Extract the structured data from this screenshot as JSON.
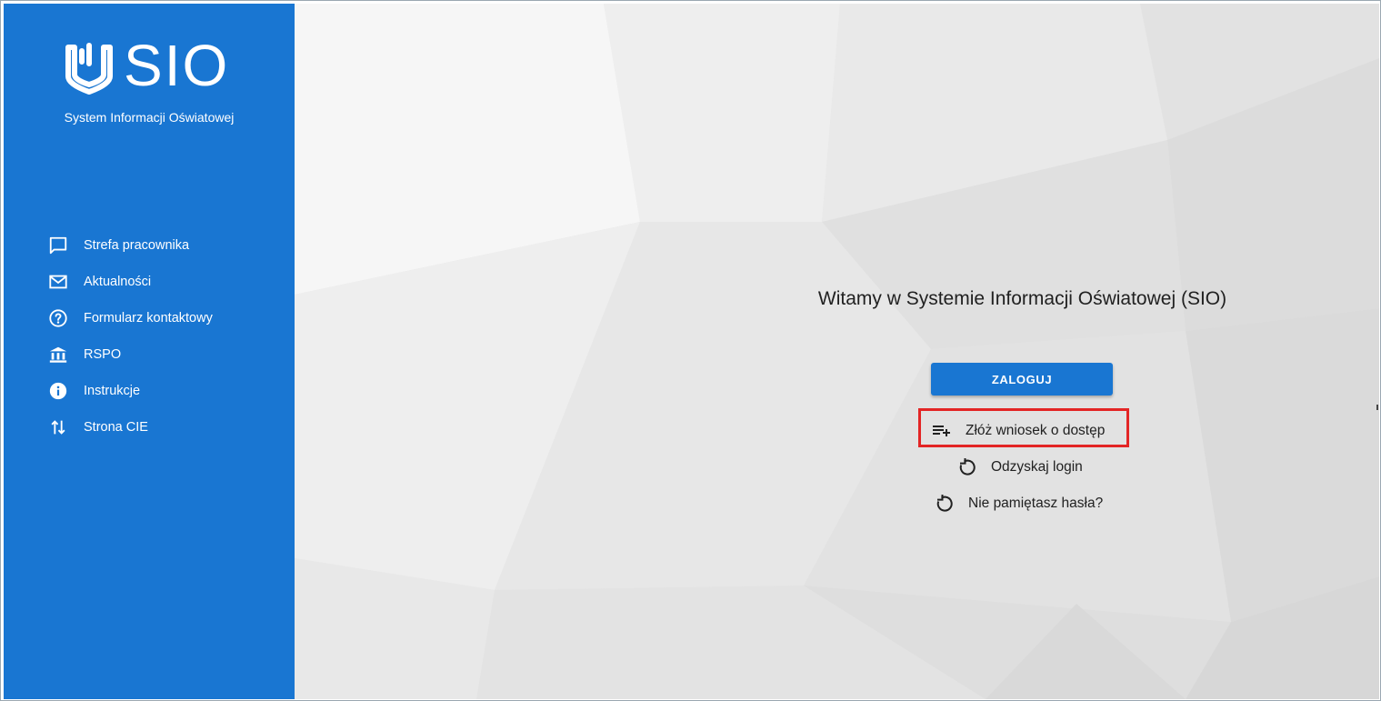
{
  "app": {
    "logo_text": "SIO",
    "subtitle": "System Informacji Oświatowej"
  },
  "sidebar": {
    "items": [
      {
        "label": "Strefa pracownika",
        "icon": "chat-bubble-icon"
      },
      {
        "label": "Aktualności",
        "icon": "mail-icon"
      },
      {
        "label": "Formularz kontaktowy",
        "icon": "help-circle-icon"
      },
      {
        "label": "RSPO",
        "icon": "bank-icon"
      },
      {
        "label": "Instrukcje",
        "icon": "info-icon"
      },
      {
        "label": "Strona CIE",
        "icon": "swap-vertical-icon"
      }
    ]
  },
  "main": {
    "title": "Witamy w Systemie Informacji Oświatowej (SIO)",
    "login_button": "ZALOGUJ",
    "actions": [
      {
        "label": "Złóż wniosek o dostęp",
        "icon": "playlist-add-icon"
      },
      {
        "label": "Odzyskaj login",
        "icon": "restore-icon"
      },
      {
        "label": "Nie pamiętasz hasła?",
        "icon": "restore-icon"
      }
    ]
  },
  "colors": {
    "sidebar_bg": "#1976d2",
    "primary": "#1976d2",
    "highlight": "#e32525",
    "text": "#212121"
  }
}
